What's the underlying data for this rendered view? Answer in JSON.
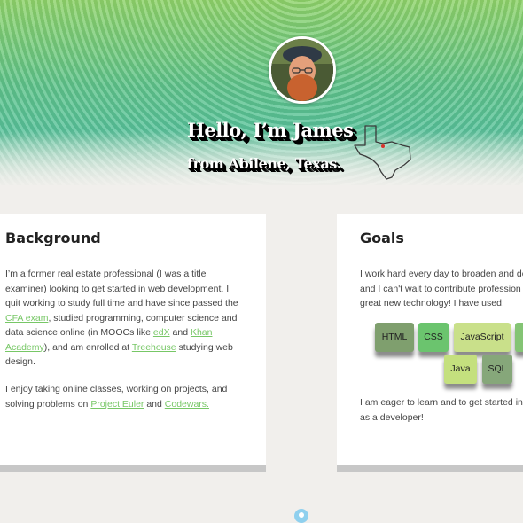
{
  "hero": {
    "title": "Hello, I’m James",
    "subtitle": "from Abilene, Texas."
  },
  "background": {
    "heading": "Background",
    "p1_a": "I’m a former real estate professional (I was a title examiner) looking to get started in web development. I quit working to study full time and have since passed the ",
    "p1_link_cfa": "CFA exam",
    "p1_b": ", studied programming, computer science and data science online (in MOOCs like ",
    "p1_link_edx": "edX",
    "p1_c": " and ",
    "p1_link_khan": "Khan Academy",
    "p1_d": "), and am enrolled at ",
    "p1_link_treehouse": "Treehouse",
    "p1_e": " studying web design.",
    "p2_a": "I enjoy taking online classes, working on projects, and solving problems on ",
    "p2_link_euler": "Project Euler",
    "p2_b": " and ",
    "p2_link_codewars": "Codewars."
  },
  "goals": {
    "heading": "Goals",
    "p1_line1": "I work hard every day to broaden and de",
    "p1_line2": "and I can't wait to contribute profession",
    "p1_line3": "great new technology! I have used:",
    "p2_line1": "I am eager to learn and to get started in",
    "p2_line2": "as a developer!",
    "skills": [
      {
        "label": "HTML",
        "color": "#7f9f6e"
      },
      {
        "label": "CSS",
        "color": "#6bc46e"
      },
      {
        "label": "JavaScript",
        "color": "#c9e08a"
      },
      {
        "label": "",
        "color": "#84c474"
      },
      {
        "label": "Java",
        "color": "#c4e07e"
      },
      {
        "label": "SQL",
        "color": "#86a77a"
      }
    ]
  },
  "colors": {
    "link": "#77c766",
    "scroll_indicator": "#8fd0ee"
  }
}
